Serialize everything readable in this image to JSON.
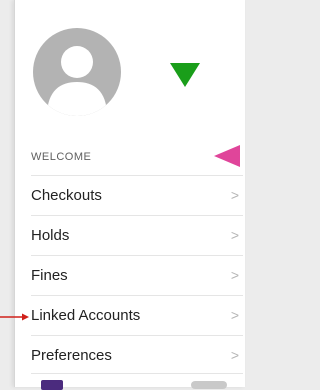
{
  "drawer": {
    "section_label": "WELCOME",
    "items": [
      {
        "label": "Checkouts",
        "chevron": ">"
      },
      {
        "label": "Holds",
        "chevron": ">"
      },
      {
        "label": "Fines",
        "chevron": ">"
      },
      {
        "label": "Linked Accounts",
        "chevron": ">"
      },
      {
        "label": "Preferences",
        "chevron": ">"
      }
    ]
  },
  "annotations": {
    "green_marker_color": "#1a9e1a",
    "pink_marker_color": "#e0459a",
    "red_arrow_color": "#d0201a"
  },
  "icons": {
    "avatar": "user-avatar-icon",
    "chevron": "chevron-right-icon"
  }
}
